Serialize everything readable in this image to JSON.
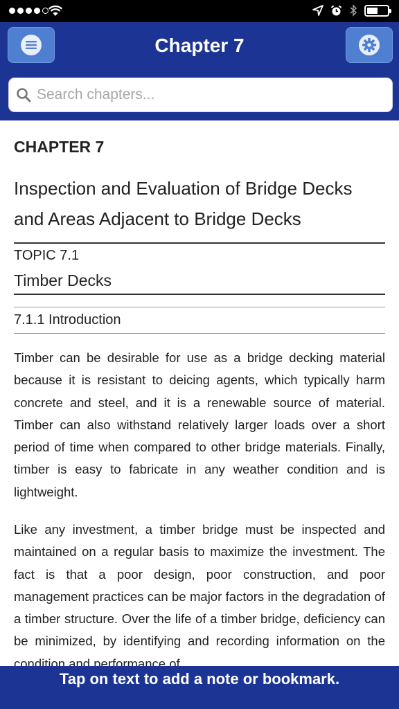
{
  "status_bar": {
    "signal_icon": "cellular-signal-dots",
    "wifi_icon": "wifi-icon",
    "location_icon": "location-arrow-icon",
    "alarm_icon": "alarm-clock-icon",
    "bluetooth_icon": "bluetooth-icon",
    "battery_icon": "battery-icon"
  },
  "header": {
    "title": "Chapter 7",
    "menu_icon": "hamburger-menu-icon",
    "settings_icon": "gear-icon",
    "bg_color": "#1c3494",
    "button_color": "#4f7fd1"
  },
  "search": {
    "placeholder": "Search chapters...",
    "value": "",
    "icon": "search-icon"
  },
  "content": {
    "chapter_label": "CHAPTER 7",
    "chapter_title": "Inspection and Evaluation of Bridge Decks and Areas Adjacent to Bridge Decks",
    "topic_label": "TOPIC 7.1",
    "topic_title": "Timber Decks",
    "section_label": "7.1.1 Introduction",
    "paragraphs": [
      "Timber can be desirable for use as a bridge decking material because it is resistant to deicing agents, which typically harm concrete and steel, and it is a renewable source of material. Timber can also withstand relatively larger loads over a short period of time when compared to other bridge materials. Finally, timber is easy to fabricate in any weather condition and is lightweight.",
      "Like any investment, a timber bridge must be inspected and maintained on a regular basis to maximize the investment. The fact is that a poor design, poor construction, and poor management practices can be major factors in the degradation of a timber structure. Over the life of a timber bridge, deficiency can be minimized, by identifying and recording information on the condition and performance of"
    ]
  },
  "footer": {
    "hint": "Tap on text to add a note or bookmark."
  }
}
